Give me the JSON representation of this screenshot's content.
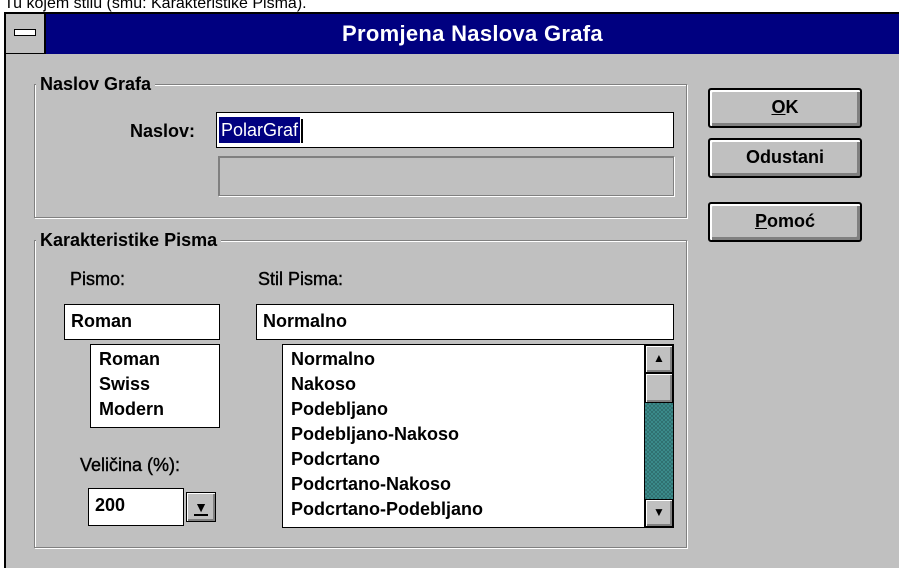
{
  "background_text": "Tu kojem stilu (smu: Karakteristike Pisma).",
  "window": {
    "title": "Promjena Naslova Grafa",
    "sysmenu_icon": "system-menu-icon"
  },
  "naslov_group": {
    "legend": "Naslov Grafa",
    "naslov_label": "Naslov:",
    "naslov_value": "PolarGraf"
  },
  "font_group": {
    "legend": "Karakteristike Pisma",
    "pismo_label": "Pismo:",
    "pismo_value": "Roman",
    "pismo_options": [
      "Roman",
      "Swiss",
      "Modern"
    ],
    "stil_label": "Stil Pisma:",
    "stil_value": "Normalno",
    "stil_options": [
      "Normalno",
      "Nakoso",
      "Podebljano",
      "Podebljano-Nakoso",
      "Podcrtano",
      "Podcrtano-Nakoso",
      "Podcrtano-Podebljano"
    ],
    "velicina_label": "Veličina (%):",
    "velicina_value": "200"
  },
  "buttons": {
    "ok": {
      "mnemonic": "O",
      "rest": "K"
    },
    "cancel": "Odustani",
    "help": {
      "mnemonic": "P",
      "rest": "omoć"
    }
  },
  "colors": {
    "title_bar": "#000080",
    "face": "#c0c0c0",
    "selection": "#000080",
    "scroll_track": "#3a8a8a"
  },
  "icons": {
    "scroll_up": "arrow-up-icon",
    "scroll_down": "arrow-down-icon",
    "dropdown": "dropdown-arrow-icon"
  }
}
